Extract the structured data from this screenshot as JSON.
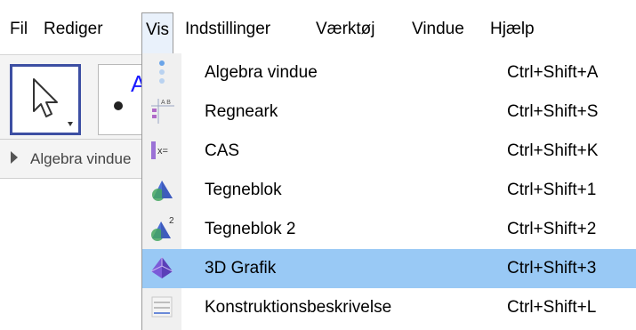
{
  "menubar": {
    "items": [
      {
        "label": "Fil"
      },
      {
        "label": "Rediger"
      },
      {
        "label": "Vis"
      },
      {
        "label": "Indstillinger"
      },
      {
        "label": "Værktøj"
      },
      {
        "label": "Vindue"
      },
      {
        "label": "Hjælp"
      }
    ],
    "open_menu": "Vis"
  },
  "toolbar": {
    "tools": [
      {
        "icon": "pointer-arrow-icon",
        "selected": true
      },
      {
        "icon": "point-tool-icon",
        "selected": false
      }
    ],
    "point_tool_glyph": "A"
  },
  "algebra_panel": {
    "title": "Algebra vindue"
  },
  "dropdown": {
    "items": [
      {
        "label": "Algebra vindue",
        "shortcut": "Ctrl+Shift+A",
        "icon": "algebra-view-icon",
        "highlighted": false
      },
      {
        "label": "Regneark",
        "shortcut": "Ctrl+Shift+S",
        "icon": "spreadsheet-icon",
        "highlighted": false
      },
      {
        "label": "CAS",
        "shortcut": "Ctrl+Shift+K",
        "icon": "cas-icon",
        "highlighted": false
      },
      {
        "label": "Tegneblok",
        "shortcut": "Ctrl+Shift+1",
        "icon": "graphics-view-icon",
        "highlighted": false
      },
      {
        "label": "Tegneblok 2",
        "shortcut": "Ctrl+Shift+2",
        "icon": "graphics-view-2-icon",
        "highlighted": false
      },
      {
        "label": "3D Grafik",
        "shortcut": "Ctrl+Shift+3",
        "icon": "graphics-3d-icon",
        "highlighted": true
      },
      {
        "label": "Konstruktionsbeskrivelse",
        "shortcut": "Ctrl+Shift+L",
        "icon": "construction-protocol-icon",
        "highlighted": false
      }
    ],
    "icon_glyphs": {
      "spreadsheet": "A B",
      "cas": "x=",
      "superscript_2": "2"
    }
  },
  "colors": {
    "highlight": "#99c9f5",
    "selected_tool_border": "#3d4fa3",
    "open_menu_bg": "#e9f1fb"
  }
}
